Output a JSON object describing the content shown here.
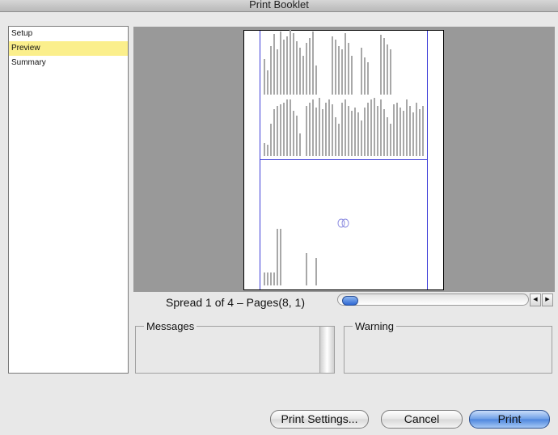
{
  "window": {
    "title": "Print Booklet"
  },
  "sidebar": {
    "items": [
      {
        "label": "Setup",
        "selected": false
      },
      {
        "label": "Preview",
        "selected": true
      },
      {
        "label": "Summary",
        "selected": false
      }
    ]
  },
  "preview": {
    "spread_label": "Spread 1 of 4 – Pages(8, 1)",
    "scroll_left_icon": "◀",
    "scroll_right_icon": "▶"
  },
  "panels": {
    "messages_label": "Messages",
    "warning_label": "Warning"
  },
  "buttons": {
    "print_settings": "Print Settings...",
    "cancel": "Cancel",
    "print": "Print"
  },
  "colors": {
    "selection": "#fbef8c",
    "preview_background": "#999999",
    "guide": "#3c3cd8",
    "primary_button": "#4d86de"
  }
}
